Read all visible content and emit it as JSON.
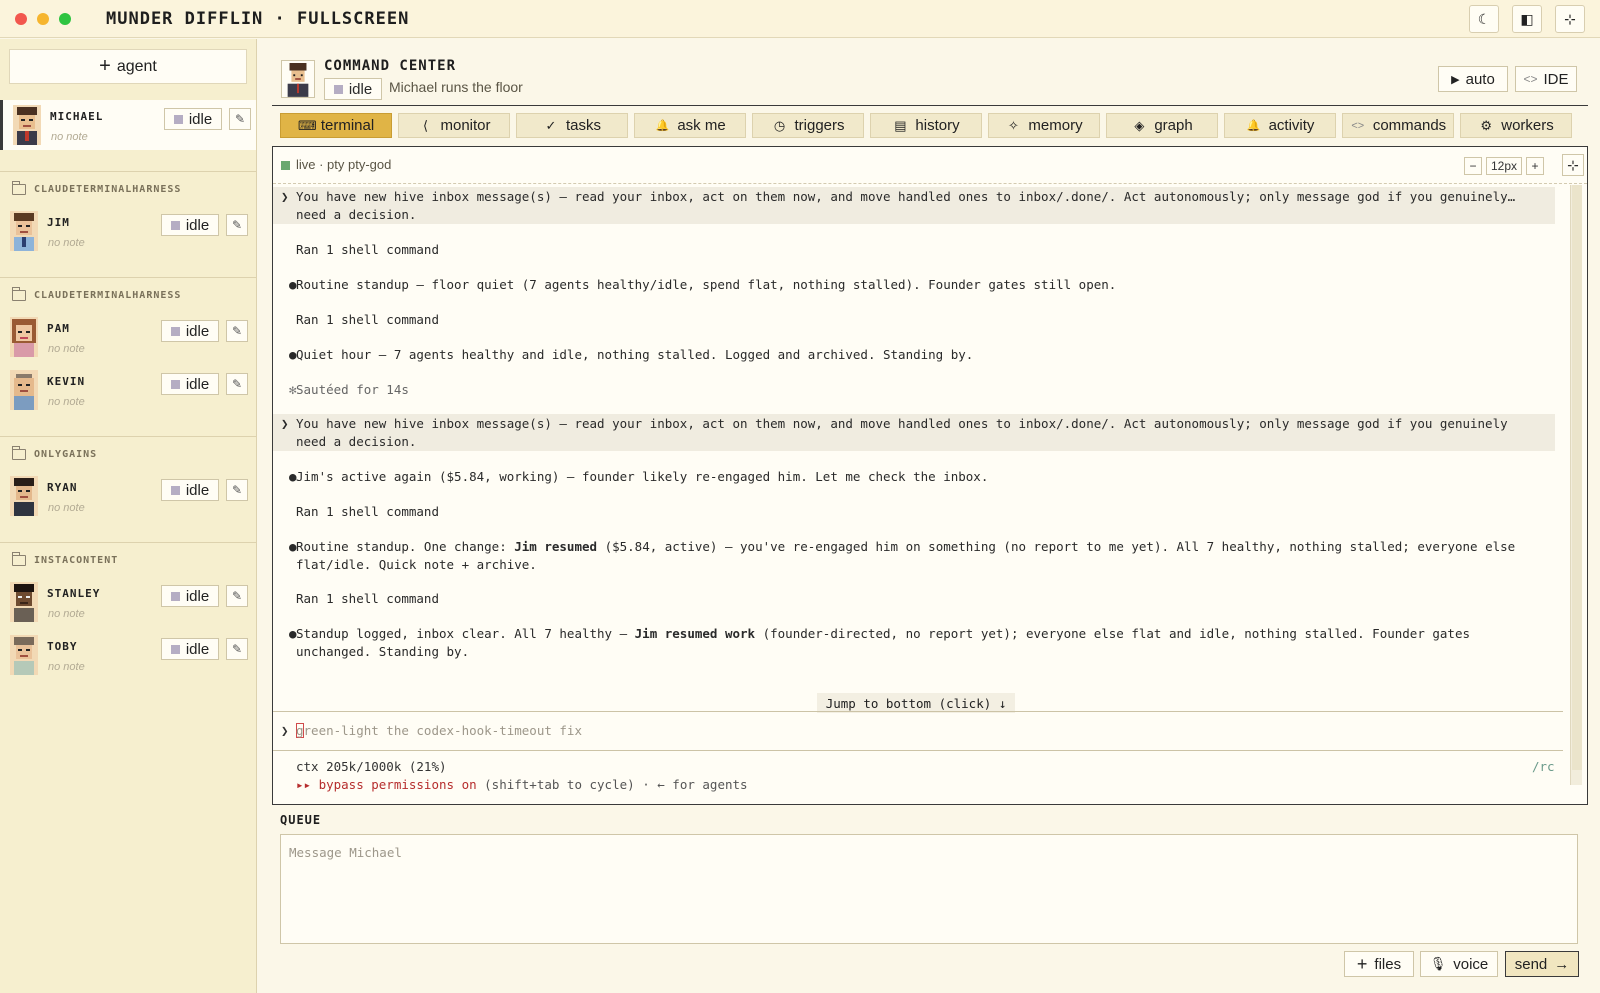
{
  "window": {
    "title": "MUNDER DIFFLIN · FULLSCREEN"
  },
  "titlebar_buttons": [
    {
      "icon": "moon-icon",
      "glyph": "☾"
    },
    {
      "icon": "sidebar-icon",
      "glyph": "◧"
    },
    {
      "icon": "collapse-icon",
      "glyph": "⊹"
    }
  ],
  "sidebar": {
    "add_agent_label": "agent",
    "michael": {
      "name": "MICHAEL",
      "status": "idle",
      "note": "no note"
    },
    "groups": [
      {
        "label": "CLAUDETERMINALHARNESS",
        "agents": [
          {
            "name": "JIM",
            "status": "idle",
            "note": "no note"
          }
        ]
      },
      {
        "label": "CLAUDETERMINALHARNESS",
        "agents": [
          {
            "name": "PAM",
            "status": "idle",
            "note": "no note"
          },
          {
            "name": "KEVIN",
            "status": "idle",
            "note": "no note"
          }
        ]
      },
      {
        "label": "ONLYGAINS",
        "agents": [
          {
            "name": "RYAN",
            "status": "idle",
            "note": "no note"
          }
        ]
      },
      {
        "label": "INSTACONTENT",
        "agents": [
          {
            "name": "STANLEY",
            "status": "idle",
            "note": "no note"
          },
          {
            "name": "TOBY",
            "status": "idle",
            "note": "no note"
          }
        ]
      }
    ]
  },
  "header": {
    "title": "COMMAND CENTER",
    "status": "idle",
    "subtitle": "Michael runs the floor",
    "auto_label": "auto",
    "ide_label": "IDE"
  },
  "tabs": [
    {
      "label": "terminal",
      "icon": "terminal-icon",
      "glyph": "⌨",
      "active": true
    },
    {
      "label": "monitor",
      "icon": "monitor-icon",
      "glyph": "⟨"
    },
    {
      "label": "tasks",
      "icon": "check-icon",
      "glyph": "✓"
    },
    {
      "label": "ask me",
      "icon": "bell-icon",
      "glyph": "🔔"
    },
    {
      "label": "triggers",
      "icon": "clock-icon",
      "glyph": "◷"
    },
    {
      "label": "history",
      "icon": "document-icon",
      "glyph": "▤"
    },
    {
      "label": "memory",
      "icon": "sparkle-icon",
      "glyph": "✧"
    },
    {
      "label": "graph",
      "icon": "graph-icon",
      "glyph": "◈"
    },
    {
      "label": "activity",
      "icon": "bell-icon",
      "glyph": "🔔"
    },
    {
      "label": "commands",
      "icon": "code-icon",
      "glyph": "<>"
    },
    {
      "label": "workers",
      "icon": "gear-icon",
      "glyph": "⚙"
    }
  ],
  "terminal": {
    "live_label": "live · pty pty-god",
    "font_size": "12px",
    "zoom_out": "−",
    "zoom_in": "+",
    "lines": [
      {
        "kind": "prompt",
        "gutter": "❯",
        "text": "You have new hive inbox message(s) — read your inbox, act on them now, and move handled ones to inbox/.done/. Act autonomously; only message god if you genuinely…\nneed a decision."
      },
      {
        "kind": "sub",
        "text": "Ran 1 shell command"
      },
      {
        "kind": "bullet",
        "gutter": "●",
        "text": "Routine standup — floor quiet (7 agents healthy/idle, spend flat, nothing stalled). Founder gates still open."
      },
      {
        "kind": "sub",
        "text": "Ran 1 shell command"
      },
      {
        "kind": "bullet",
        "gutter": "●",
        "text": "Quiet hour — 7 agents healthy and idle, nothing stalled. Logged and archived. Standing by."
      },
      {
        "kind": "star",
        "gutter": "✻",
        "text": "Sautéed for 14s"
      },
      {
        "kind": "prompt",
        "gutter": "❯",
        "text": "You have new hive inbox message(s) — read your inbox, act on them now, and move handled ones to inbox/.done/. Act autonomously; only message god if you genuinely\nneed a decision."
      },
      {
        "kind": "bullet",
        "gutter": "●",
        "text": "Jim's active again ($5.84, working) — founder likely re-engaged him. Let me check the inbox."
      },
      {
        "kind": "sub",
        "text": "Ran 1 shell command"
      },
      {
        "kind": "bullet",
        "gutter": "●",
        "text_before": "Routine standup. One change: ",
        "bold": "Jim resumed",
        "text_after": " ($5.84, active) — you've re-engaged him on something (no report to me yet). All 7 healthy, nothing stalled; everyone else\nflat/idle. Quick note + archive."
      },
      {
        "kind": "sub",
        "text": "Ran 1 shell command"
      },
      {
        "kind": "bullet",
        "gutter": "●",
        "text_before": "Standup logged, inbox clear. All 7 healthy — ",
        "bold": "Jim resumed work",
        "text_after": " (founder-directed, no report yet); everyone else flat and idle, nothing stalled. Founder gates\nunchanged. Standing by."
      }
    ],
    "jump_label": "Jump to bottom (click) ↓",
    "input_chevron": "❯",
    "input_text": "green-light the codex-hook-timeout fix",
    "ctx": "ctx 205k/1000k (21%)",
    "bypass": "▸▸ bypass permissions on",
    "bypass_hint": " (shift+tab to cycle) · ← for agents",
    "rc": "/rc"
  },
  "queue": {
    "label": "QUEUE",
    "placeholder": "Message Michael",
    "files_label": "files",
    "voice_label": "voice",
    "send_label": "send"
  }
}
